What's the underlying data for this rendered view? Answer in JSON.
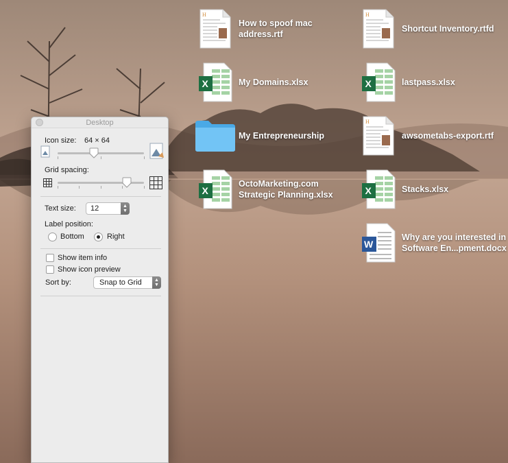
{
  "panel": {
    "title": "Desktop",
    "icon_size_label": "Icon size:",
    "icon_size_value": "64 × 64",
    "icon_size_level": 0.42,
    "grid_spacing_label": "Grid spacing:",
    "grid_spacing_level": 0.8,
    "text_size_label": "Text size:",
    "text_size_value": "12",
    "label_position_label": "Label position:",
    "label_position_options": [
      "Bottom",
      "Right"
    ],
    "label_position_selected": "Right",
    "show_item_info_label": "Show item info",
    "show_item_info_checked": false,
    "show_icon_preview_label": "Show icon preview",
    "show_icon_preview_checked": false,
    "sort_by_label": "Sort by:",
    "sort_by_value": "Snap to Grid"
  },
  "desktop_items": [
    {
      "name": "How to spoof mac\naddress.rtf",
      "icon": "rtf-document-icon"
    },
    {
      "name": "My Domains.xlsx",
      "icon": "excel-icon"
    },
    {
      "name": "My Entrepreneurship",
      "icon": "folder-icon"
    },
    {
      "name": "OctoMarketing.com\nStrategic Planning.xlsx",
      "icon": "excel-icon"
    },
    {
      "name": "Shortcut Inventory.rtfd",
      "icon": "rtf-document-icon"
    },
    {
      "name": "lastpass.xlsx",
      "icon": "excel-icon"
    },
    {
      "name": "awsometabs-export.rtf",
      "icon": "rtf-document-icon"
    },
    {
      "name": "Stacks.xlsx",
      "icon": "excel-icon"
    },
    {
      "name": "Why are you interested in\nSoftware En...pment.docx",
      "icon": "word-icon"
    }
  ],
  "colors": {
    "excel_green": "#1d6f42",
    "word_blue": "#2b579a",
    "folder_blue": "#5ab8f0"
  }
}
